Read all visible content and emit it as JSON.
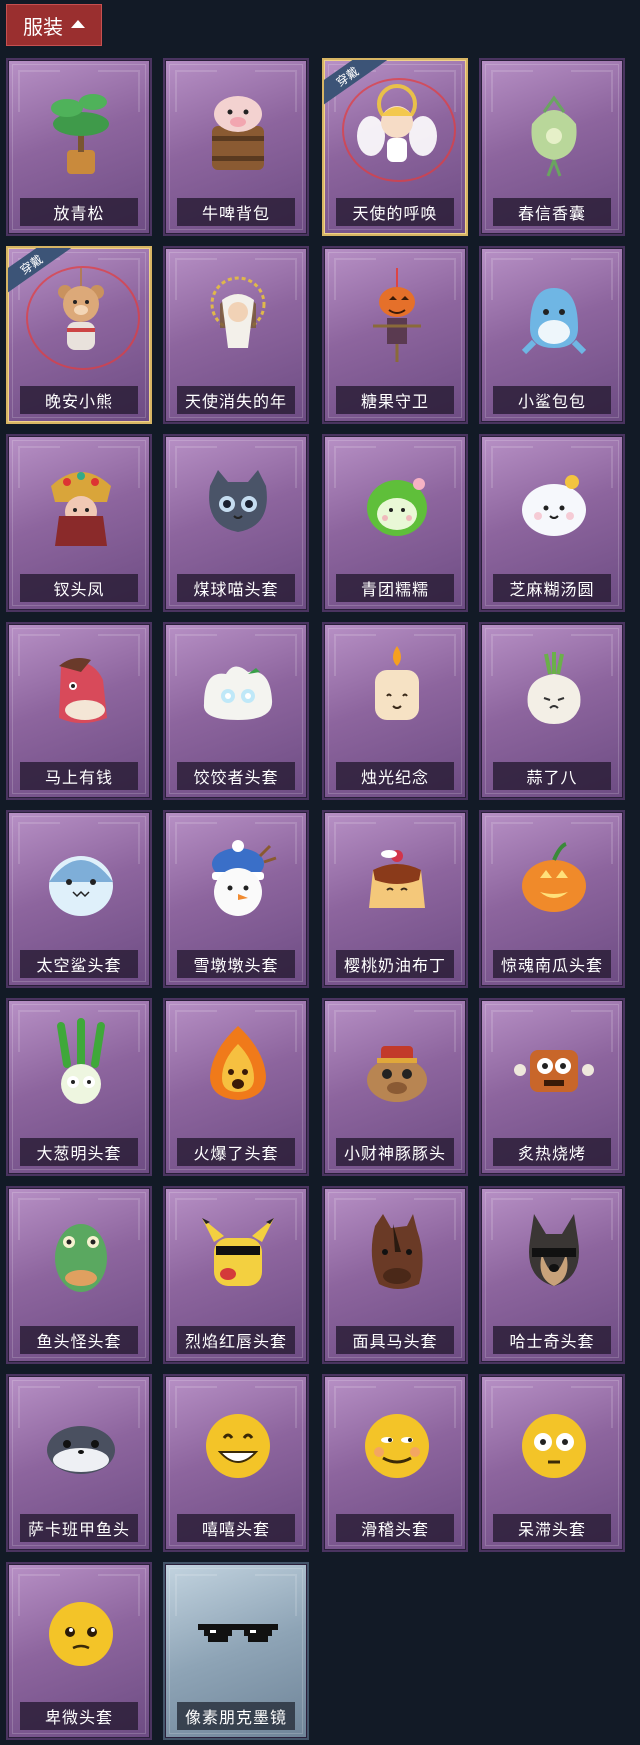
{
  "header": {
    "label": "服装"
  },
  "items": [
    {
      "name": "放青松",
      "equipped": false,
      "icon": "potted-pine-icon"
    },
    {
      "name": "牛啤背包",
      "equipped": false,
      "icon": "cow-beer-backpack-icon"
    },
    {
      "name": "天使的呼唤",
      "equipped": true,
      "badge": "穿戴",
      "icon": "angel-charm-icon"
    },
    {
      "name": "春信香囊",
      "equipped": false,
      "icon": "sachet-icon"
    },
    {
      "name": "晚安小熊",
      "equipped": true,
      "badge": "穿戴",
      "icon": "teddy-bear-charm-icon"
    },
    {
      "name": "天使消失的年",
      "equipped": false,
      "icon": "angel-girl-charm-icon"
    },
    {
      "name": "糖果守卫",
      "equipped": false,
      "icon": "pumpkin-guard-icon"
    },
    {
      "name": "小鲨包包",
      "equipped": false,
      "icon": "shark-bag-icon"
    },
    {
      "name": "钗头凤",
      "equipped": false,
      "icon": "phoenix-crown-icon"
    },
    {
      "name": "煤球喵头套",
      "equipped": false,
      "icon": "cat-head-icon"
    },
    {
      "name": "青团糯糯",
      "equipped": false,
      "icon": "green-dumpling-head-icon"
    },
    {
      "name": "芝麻糊汤圆",
      "equipped": false,
      "icon": "rice-ball-head-icon"
    },
    {
      "name": "马上有钱",
      "equipped": false,
      "icon": "red-horse-head-icon"
    },
    {
      "name": "饺饺者头套",
      "equipped": false,
      "icon": "dumpling-head-icon"
    },
    {
      "name": "烛光纪念",
      "equipped": false,
      "icon": "candle-head-icon"
    },
    {
      "name": "蒜了八",
      "equipped": false,
      "icon": "garlic-head-icon"
    },
    {
      "name": "太空鲨头套",
      "equipped": false,
      "icon": "space-shark-head-icon"
    },
    {
      "name": "雪墩墩头套",
      "equipped": false,
      "icon": "snowman-head-icon"
    },
    {
      "name": "樱桃奶油布丁",
      "equipped": false,
      "icon": "pudding-head-icon"
    },
    {
      "name": "惊魂南瓜头套",
      "equipped": false,
      "icon": "jack-o-lantern-head-icon"
    },
    {
      "name": "大葱明头套",
      "equipped": false,
      "icon": "scallion-head-icon"
    },
    {
      "name": "火爆了头套",
      "equipped": false,
      "icon": "fire-head-icon"
    },
    {
      "name": "小财神豚豚头",
      "equipped": false,
      "icon": "capybara-head-icon"
    },
    {
      "name": "炙热烧烤",
      "equipped": false,
      "icon": "bbq-head-icon"
    },
    {
      "name": "鱼头怪头套",
      "equipped": false,
      "icon": "fish-head-icon"
    },
    {
      "name": "烈焰红唇头套",
      "equipped": false,
      "icon": "yellow-mouse-head-icon"
    },
    {
      "name": "面具马头套",
      "equipped": false,
      "icon": "horse-mask-icon"
    },
    {
      "name": "哈士奇头套",
      "equipped": false,
      "icon": "husky-head-icon"
    },
    {
      "name": "萨卡班甲鱼头",
      "equipped": false,
      "icon": "sacabambaspis-head-icon"
    },
    {
      "name": "嘻嘻头套",
      "equipped": false,
      "icon": "grin-emoji-head-icon"
    },
    {
      "name": "滑稽头套",
      "equipped": false,
      "icon": "smirk-emoji-head-icon"
    },
    {
      "name": "呆滞头套",
      "equipped": false,
      "icon": "blank-stare-emoji-head-icon"
    },
    {
      "name": "卑微头套",
      "equipped": false,
      "icon": "pleading-emoji-head-icon"
    },
    {
      "name": "像素朋克墨镜",
      "equipped": false,
      "icon": "pixel-sunglasses-icon",
      "rarity": "blue"
    }
  ]
}
